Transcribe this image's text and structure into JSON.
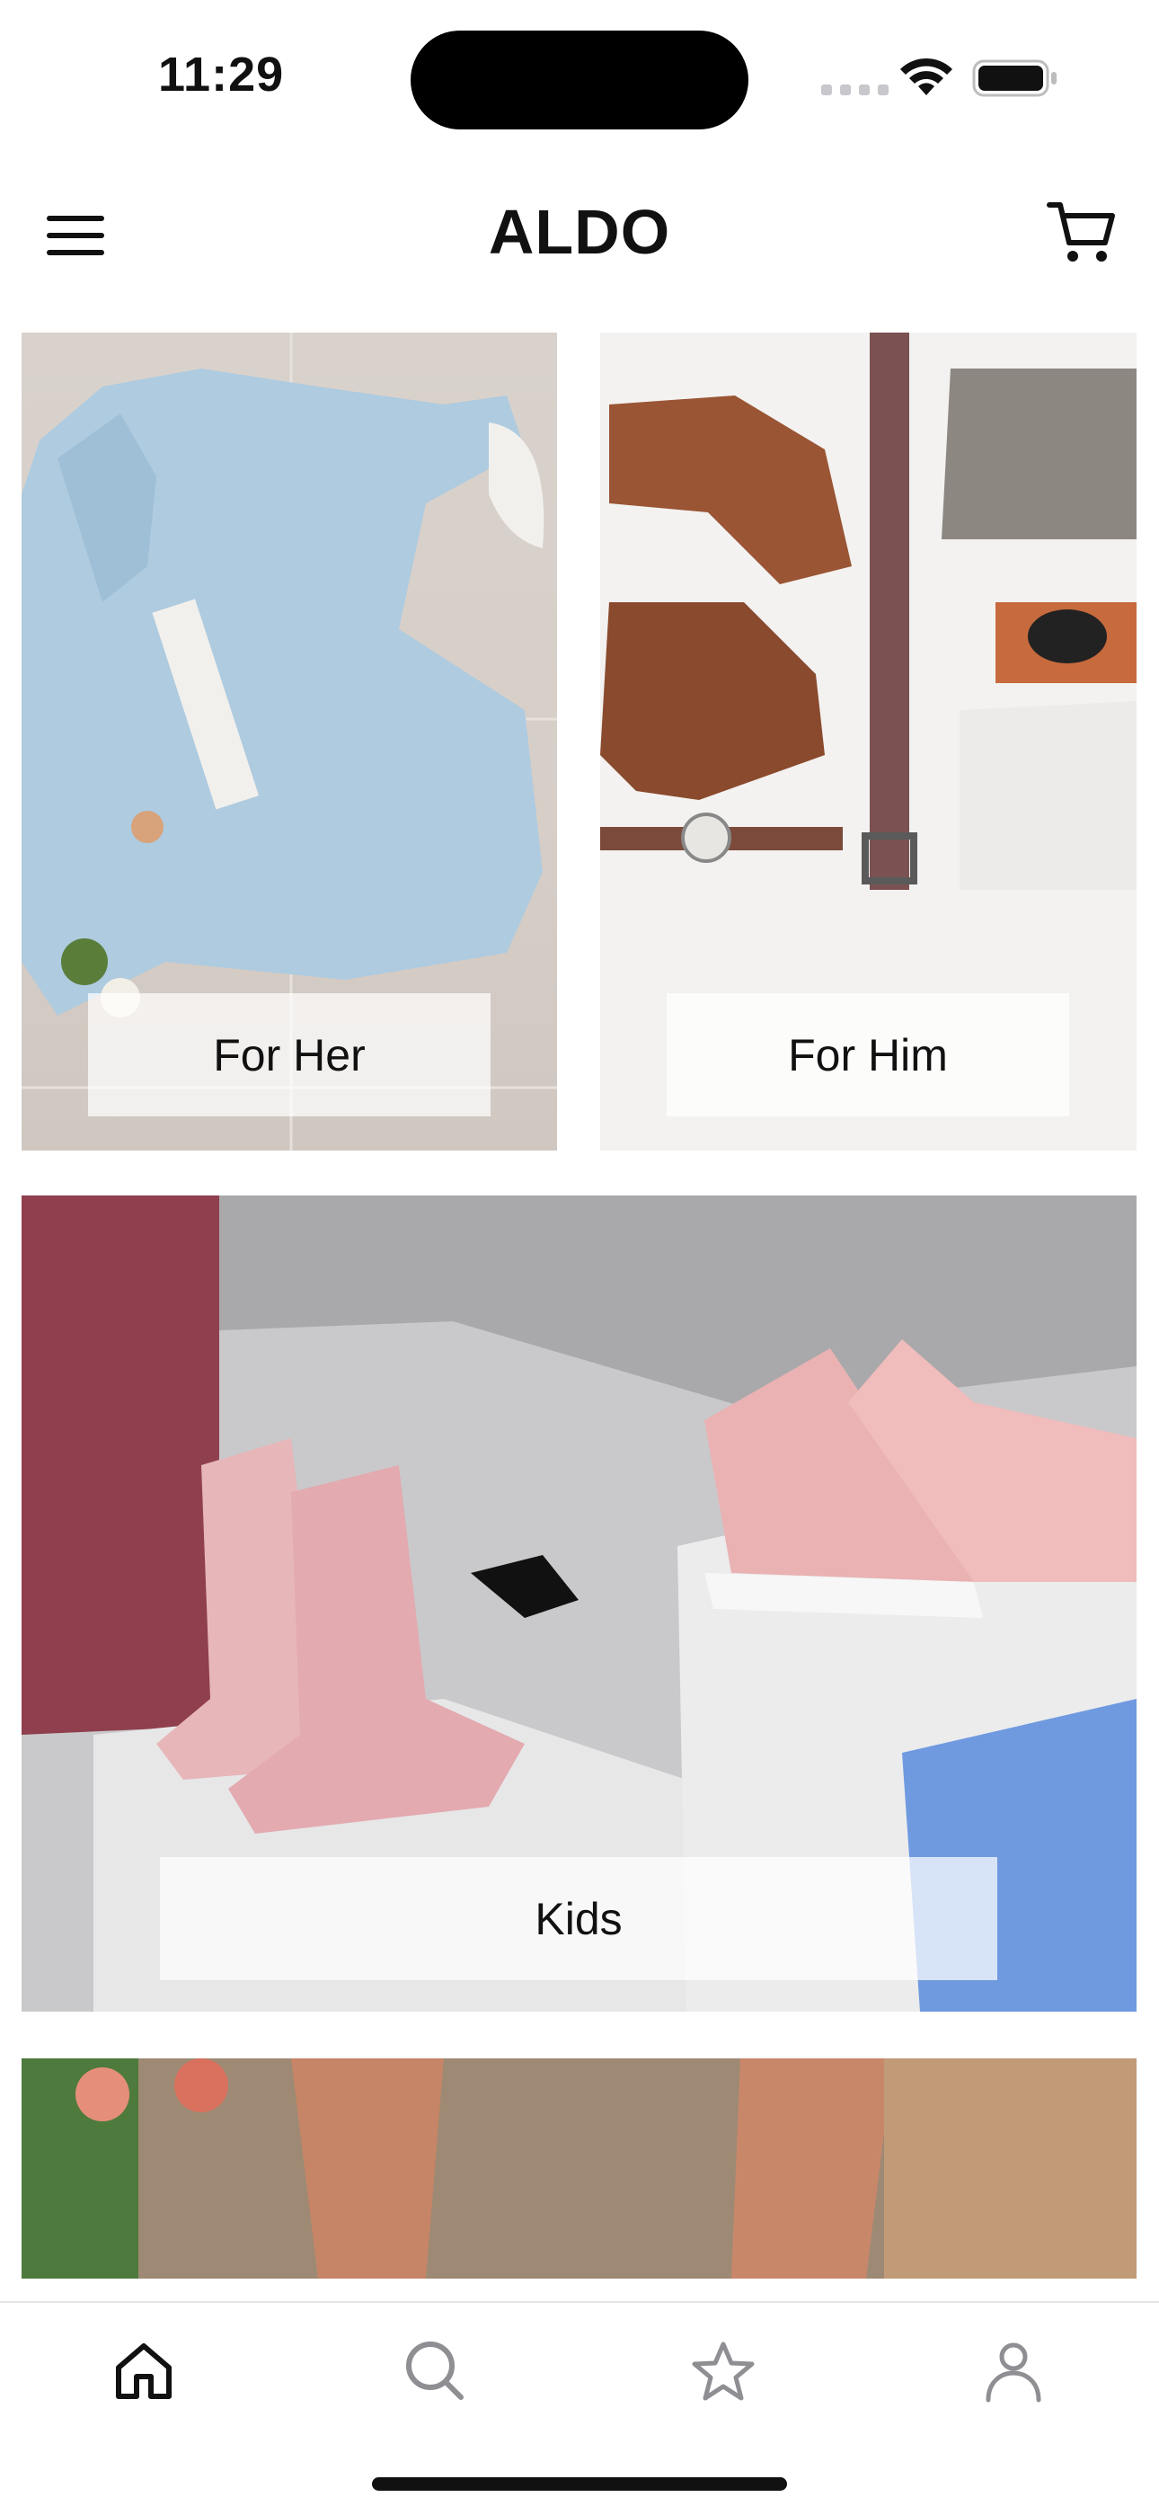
{
  "status": {
    "time": "11:29"
  },
  "header": {
    "brand": "ALDO"
  },
  "tiles": [
    {
      "label": "For Her"
    },
    {
      "label": "For Him"
    },
    {
      "label": "Kids"
    }
  ],
  "nav": {
    "items": [
      "home-icon",
      "search-icon",
      "star-icon",
      "person-icon"
    ],
    "active_color": "#111111",
    "inactive_color": "#8e8e93"
  }
}
